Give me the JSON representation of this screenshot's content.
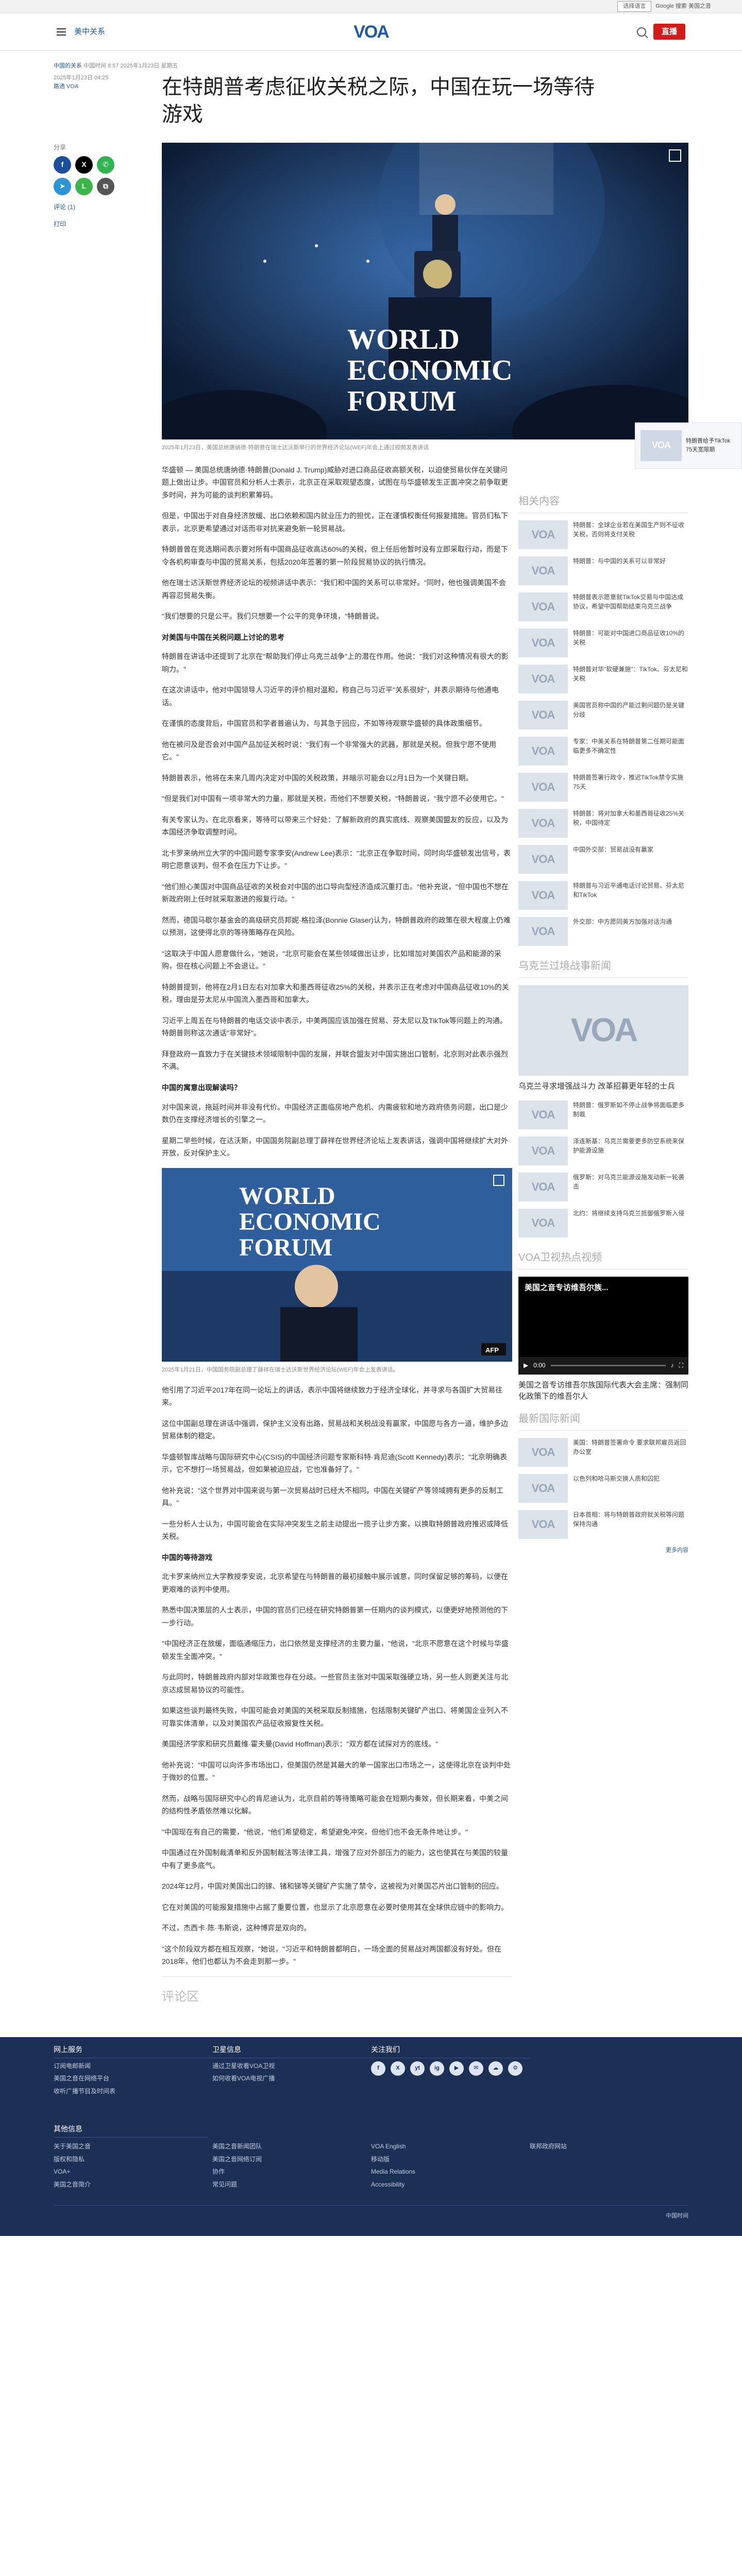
{
  "topbar": {
    "language": "选择语言",
    "search_hint": "Google 搜索 美国之音"
  },
  "header": {
    "section": "美中关系",
    "logo": "VOA",
    "live_label": "直播"
  },
  "article": {
    "category": "中国的关系",
    "updated": "中国时间 8:57 2025年1月23日 星期五",
    "date": "2025年1月23日 04:25",
    "author": "路透 VOA",
    "title": "在特朗普考虑征收关税之际，中国在玩一场等待游戏",
    "share_label": "分享",
    "comments_label": "评论 (1)",
    "print_label": "打印",
    "hero_caption": "2025年1月23日，美国总统唐纳德·特朗普在瑞士达沃斯举行的世界经济论坛(WEF)年会上通过视频发表讲话",
    "hero_text_1": "WORLD",
    "hero_text_2": "ECONOMIC",
    "hero_text_3": "FORUM",
    "paragraphs_a": [
      "华盛顿 — 美国总统唐纳德·特朗普(Donald J. Trump)威胁对进口商品征收高额关税，以迫使贸易伙伴在关键问题上做出让步。中国官员和分析人士表示，北京正在采取观望态度，试图在与华盛顿发生正面冲突之前争取更多时间，并为可能的谈判积累筹码。",
      "但是，中国出于对自身经济放缓、出口依赖和国内就业压力的担忧，正在谨慎权衡任何报复措施。官员们私下表示，北京更希望通过对话而非对抗来避免新一轮贸易战。",
      "特朗普曾在竞选期间表示要对所有中国商品征收高达60%的关税，但上任后他暂时没有立即采取行动，而是下令各机构审查与中国的贸易关系，包括2020年签署的第一阶段贸易协议的执行情况。",
      "他在瑞士达沃斯世界经济论坛的视频讲话中表示：\"我们和中国的关系可以非常好。\"同时，他也强调美国不会再容忍贸易失衡。",
      "\"我们想要的只是公平。我们只想要一个公平的竞争环境，\"特朗普说。"
    ],
    "subhead_1": "对美国与中国在关税问题上讨论的思考",
    "paragraphs_b": [
      "特朗普在讲话中还提到了北京在\"帮助我们停止乌克兰战争\"上的潜在作用。他说：\"我们对这种情况有很大的影响力。\"",
      "在这次讲话中，他对中国领导人习近平的评价相对温和，称自己与习近平\"关系很好\"，并表示期待与他通电话。",
      "在谨慎的态度背后，中国官员和学者普遍认为，与其急于回应，不如等待观察华盛顿的具体政策细节。",
      "他在被问及是否会对中国产品加征关税时说：\"我们有一个非常强大的武器，那就是关税。但我宁愿不使用它。\"",
      "特朗普表示，他将在未来几周内决定对中国的关税政策，并暗示可能会以2月1日为一个关键日期。"
    ],
    "paragraphs_c": [
      "\"但是我们对中国有一项非常大的力量，那就是关税，而他们不想要关税，\"特朗普说，\"我宁愿不必使用它。\"",
      "有关专家认为，在北京看来，等待可以带来三个好处：了解新政府的真实底线、观察美国盟友的反应，以及为本国经济争取调整时间。",
      "北卡罗来纳州立大学的中国问题专家李安(Andrew Lee)表示：\"北京正在争取时间，同时向华盛顿发出信号，表明它愿意谈判，但不会在压力下让步。\"",
      "\"他们担心美国对中国商品征收的关税会对中国的出口导向型经济造成沉重打击。\"他补充说，\"但中国也不想在新政府刚上任时就采取激进的报复行动。\"",
      "然而，德国马歇尔基金会的高级研究员邦妮·格拉泽(Bonnie Glaser)认为，特朗普政府的政策在很大程度上仍难以预测，这使得北京的等待策略存在风险。",
      "\"这取决于中国人愿意做什么，\"她说，\"北京可能会在某些领域做出让步，比如增加对美国农产品和能源的采购，但在核心问题上不会退让。\"",
      "特朗普提到，他将在2月1日左右对加拿大和墨西哥征收25%的关税，并表示正在考虑对中国商品征收10%的关税，理由是芬太尼从中国流入墨西哥和加拿大。",
      "习近平上周五在与特朗普的电话交谈中表示，中美两国应该加强在贸易、芬太尼以及TikTok等问题上的沟通。特朗普则称这次通话\"非常好\"。",
      "拜登政府一直致力于在关键技术领域限制中国的发展，并联合盟友对中国实施出口管制，北京则对此表示强烈不满。"
    ],
    "subhead_2": "中国的寓意出现解读吗？",
    "paragraphs_d": [
      "对中国来说，拖延时间并非没有代价。中国经济正面临房地产危机、内需疲软和地方政府债务问题，出口是少数仍在支撑经济增长的引擎之一。",
      "星期二早些时候，在达沃斯，中国国务院副总理丁薛祥在世界经济论坛上发表讲话，强调中国将继续扩大对外开放，反对保护主义。"
    ],
    "img2_text_1": "WORLD",
    "img2_text_2": "ECONOMIC",
    "img2_text_3": "FORUM",
    "img2_caption": "2025年1月21日，中国国务院副总理丁薛祥在瑞士达沃斯世界经济论坛(WEF)年会上发表讲话。",
    "paragraphs_e": [
      "他引用了习近平2017年在同一论坛上的讲话，表示中国将继续致力于经济全球化，并寻求与各国扩大贸易往来。",
      "这位中国副总理在讲话中强调，保护主义没有出路，贸易战和关税战没有赢家，中国愿与各方一道，维护多边贸易体制的稳定。",
      "华盛顿智库战略与国际研究中心(CSIS)的中国经济问题专家斯科特·肯尼迪(Scott Kennedy)表示：\"北京明确表示，它不想打一场贸易战，但如果被迫应战，它也准备好了。\"",
      "他补充说：\"这个世界对中国来说与第一次贸易战时已经大不相同。中国在关键矿产等领域拥有更多的反制工具。\"",
      "一些分析人士认为，中国可能会在实际冲突发生之前主动提出一揽子让步方案，以换取特朗普政府推迟或降低关税。"
    ],
    "subhead_3": "中国的等待游戏",
    "paragraphs_f": [
      "北卡罗来纳州立大学教授李安说，北京希望在与特朗普的最初接触中展示诚意，同时保留足够的筹码，以便在更艰难的谈判中使用。",
      "熟悉中国决策层的人士表示，中国的官员们已经在研究特朗普第一任期内的谈判模式，以便更好地预测他的下一步行动。",
      "\"中国经济正在放缓，面临通缩压力，出口依然是支撑经济的主要力量，\"他说，\"北京不愿意在这个时候与华盛顿发生全面冲突。\"",
      "与此同时，特朗普政府内部对华政策也存在分歧。一些官员主张对中国采取强硬立场，另一些人则更关注与北京达成贸易协议的可能性。",
      "如果这些谈判最终失败，中国可能会对美国的关税采取反制措施，包括限制关键矿产出口、将美国企业列入不可靠实体清单，以及对美国农产品征收报复性关税。",
      "美国经济学家和研究员戴维·霍夫曼(David Hoffman)表示：\"双方都在试探对方的底线。\"",
      "他补充说：\"中国可以向许多市场出口，但美国仍然是其最大的单一国家出口市场之一，这使得北京在谈判中处于微妙的位置。\"",
      "然而，战略与国际研究中心的肯尼迪认为，北京目前的等待策略可能会在短期内奏效，但长期来看，中美之间的结构性矛盾依然难以化解。",
      "\"中国现在有自己的需要，\"他说，\"他们希望稳定，希望避免冲突，但他们也不会无条件地让步。\"",
      "中国通过在外国制裁清单和反外国制裁法等法律工具，增强了应对外部压力的能力，这也使其在与美国的较量中有了更多底气。",
      "2024年12月，中国对美国出口的镓、锗和锑等关键矿产实施了禁令，这被视为对美国芯片出口管制的回应。",
      "它在对美国的可能报复措施中占据了重要位置，也显示了北京愿意在必要时使用其在全球供应链中的影响力。",
      "不过，杰西卡·陈·韦斯说，这种博弈是双向的。",
      "\"这个阶段双方都在相互观察，\"她说，\"习近平和特朗普都明白，一场全面的贸易战对两国都没有好处。但在2018年，他们也都认为不会走到那一步。\""
    ],
    "comments_heading": "评论区"
  },
  "sidebar": {
    "related_heading": "相关内容",
    "related": [
      "特朗普：全球企业若在美国生产则不征收关税，否则将支付关税",
      "特朗普：与中国的关系可以非常好",
      "特朗普表示愿意就TikTok交易与中国达成协议，希望中国帮助结束乌克兰战争",
      "特朗普：可能对中国进口商品征收10%的关税",
      "特朗普对华\"软硬兼施\"：TikTok、芬太尼和关税",
      "美国官员称中国的产能过剩问题仍是关键分歧",
      "专家：中美关系在特朗普第二任期可能面临更多不确定性",
      "特朗普签署行政令，推迟TikTok禁令实施75天",
      "特朗普：将对加拿大和墨西哥征收25%关税，中国待定",
      "中国外交部：贸易战没有赢家",
      "特朗普与习近平通电话讨论贸易、芬太尼和TikTok",
      "外交部：中方愿同美方加强对话沟通"
    ],
    "focus_heading": "乌克兰过境战事新闻",
    "focus_title": "乌克兰寻求增强战斗力 改革招募更年轻的士兵",
    "focus_list": [
      "特朗普：俄罗斯如不停止战争将面临更多制裁",
      "泽连斯基：乌克兰需要更多防空系统来保护能源设施",
      "俄罗斯：对乌克兰能源设施发动新一轮袭击",
      "北约：将继续支持乌克兰抵御俄罗斯入侵"
    ],
    "video_heading": "VOA卫视热点视频",
    "video_overlay": "美国之音专访维吾尔族...",
    "video_time": "0:00",
    "video_title": "美国之音专访维吾尔族国际代表大会主席：强制同化政策下的维吾尔人",
    "intl_heading": "最新国际新闻",
    "intl_list": [
      "美国：特朗普签署命令 要求联邦雇员返回办公室",
      "以色列和哈马斯交换人质和囚犯",
      "日本首相：将与特朗普政府就关税等问题保持沟通"
    ],
    "more_label": "更多内容"
  },
  "sticky": {
    "text": "特朗普给予TikTok 75天宽限期"
  },
  "footer": {
    "col1_title": "网上服务",
    "col1": [
      "订阅电邮新闻",
      "美国之音在网络平台",
      "收听广播节目及时间表"
    ],
    "col2_title": "卫星信息",
    "col2": [
      "通过卫星收看VOA卫视",
      "如何收看VOA电视广播"
    ],
    "col3_title": "关注我们",
    "social": [
      "f",
      "X",
      "yt",
      "ig",
      "▶",
      "✉",
      "☁",
      "⚙"
    ],
    "other_title": "其他信息",
    "other": [
      "关于美国之音",
      "美国之音新闻团队",
      "VOA English",
      "联邦政府网站",
      "版权和隐私",
      "美国之音网络订阅",
      "移动版",
      "",
      "VOA+",
      "协作",
      "Media Relations",
      "",
      "美国之音简介",
      "常见问题",
      "Accessibility",
      ""
    ],
    "bottom": "中国时间"
  }
}
